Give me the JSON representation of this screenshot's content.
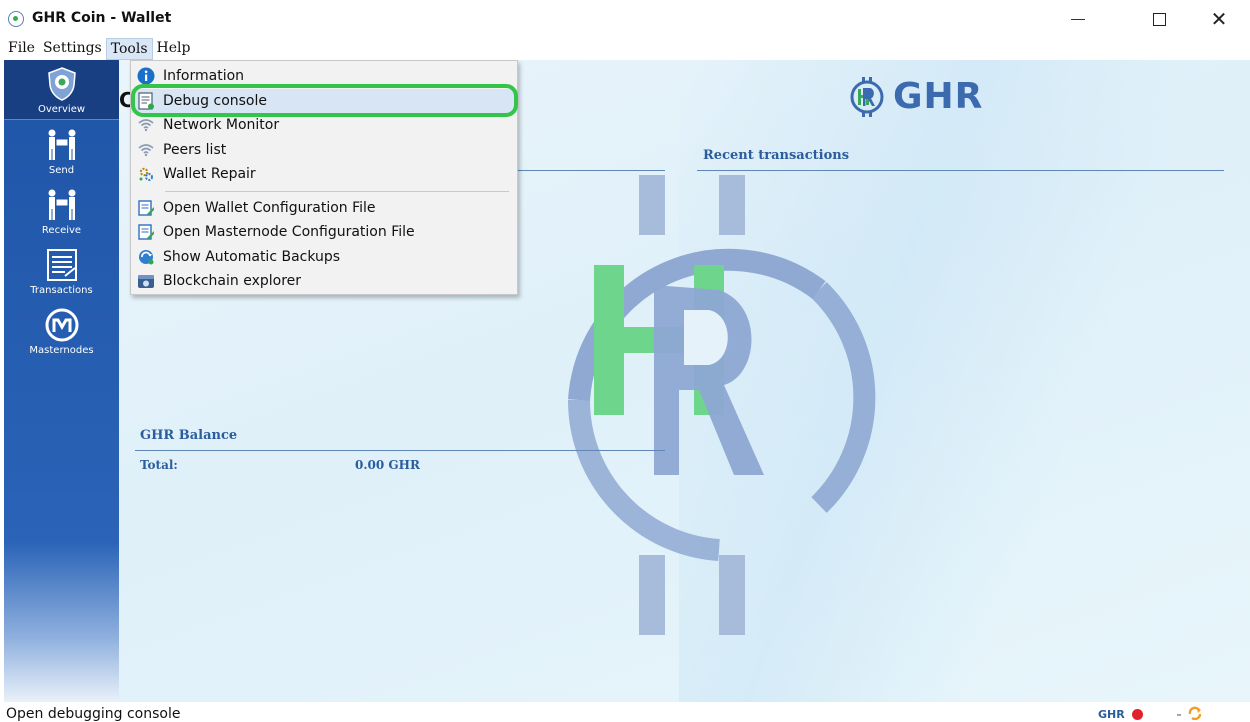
{
  "window": {
    "title": "GHR Coin - Wallet"
  },
  "menubar": {
    "items": [
      "File",
      "Settings",
      "Tools",
      "Help"
    ]
  },
  "sidebar": {
    "items": [
      {
        "label": "Overview",
        "icon": "shield-logo-icon"
      },
      {
        "label": "Send",
        "icon": "send-people-icon"
      },
      {
        "label": "Receive",
        "icon": "receive-people-icon"
      },
      {
        "label": "Transactions",
        "icon": "ledger-icon"
      },
      {
        "label": "Masternodes",
        "icon": "masternode-icon"
      }
    ]
  },
  "tools_menu": {
    "items": [
      {
        "label": "Information",
        "icon": "info-icon"
      },
      {
        "label": "Debug console",
        "icon": "console-icon",
        "highlighted": true
      },
      {
        "label": "Network Monitor",
        "icon": "wifi-icon"
      },
      {
        "label": "Peers list",
        "icon": "wifi-icon"
      },
      {
        "label": "Wallet Repair",
        "icon": "repair-icon"
      },
      {
        "label": "Open Wallet Configuration File",
        "icon": "edit-document-icon"
      },
      {
        "label": "Open Masternode Configuration File",
        "icon": "edit-document-icon"
      },
      {
        "label": "Show Automatic Backups",
        "icon": "backup-icon"
      },
      {
        "label": "Blockchain explorer",
        "icon": "explorer-icon"
      }
    ]
  },
  "overview": {
    "brand_text": "GHR",
    "title_partial": "C",
    "recent_transactions_heading": "Recent transactions",
    "balance_heading": "GHR Balance",
    "total_label": "Total:",
    "total_value": "0.00 GHR"
  },
  "statusbar": {
    "text": "Open debugging console",
    "unit": "GHR",
    "connection_status_color": "#e0202a"
  },
  "colors": {
    "sidebar_blue": "#1f55a7",
    "heading_blue": "#2b5d9d",
    "brand_green": "#3aa85a",
    "highlight_green": "#35c44a"
  }
}
